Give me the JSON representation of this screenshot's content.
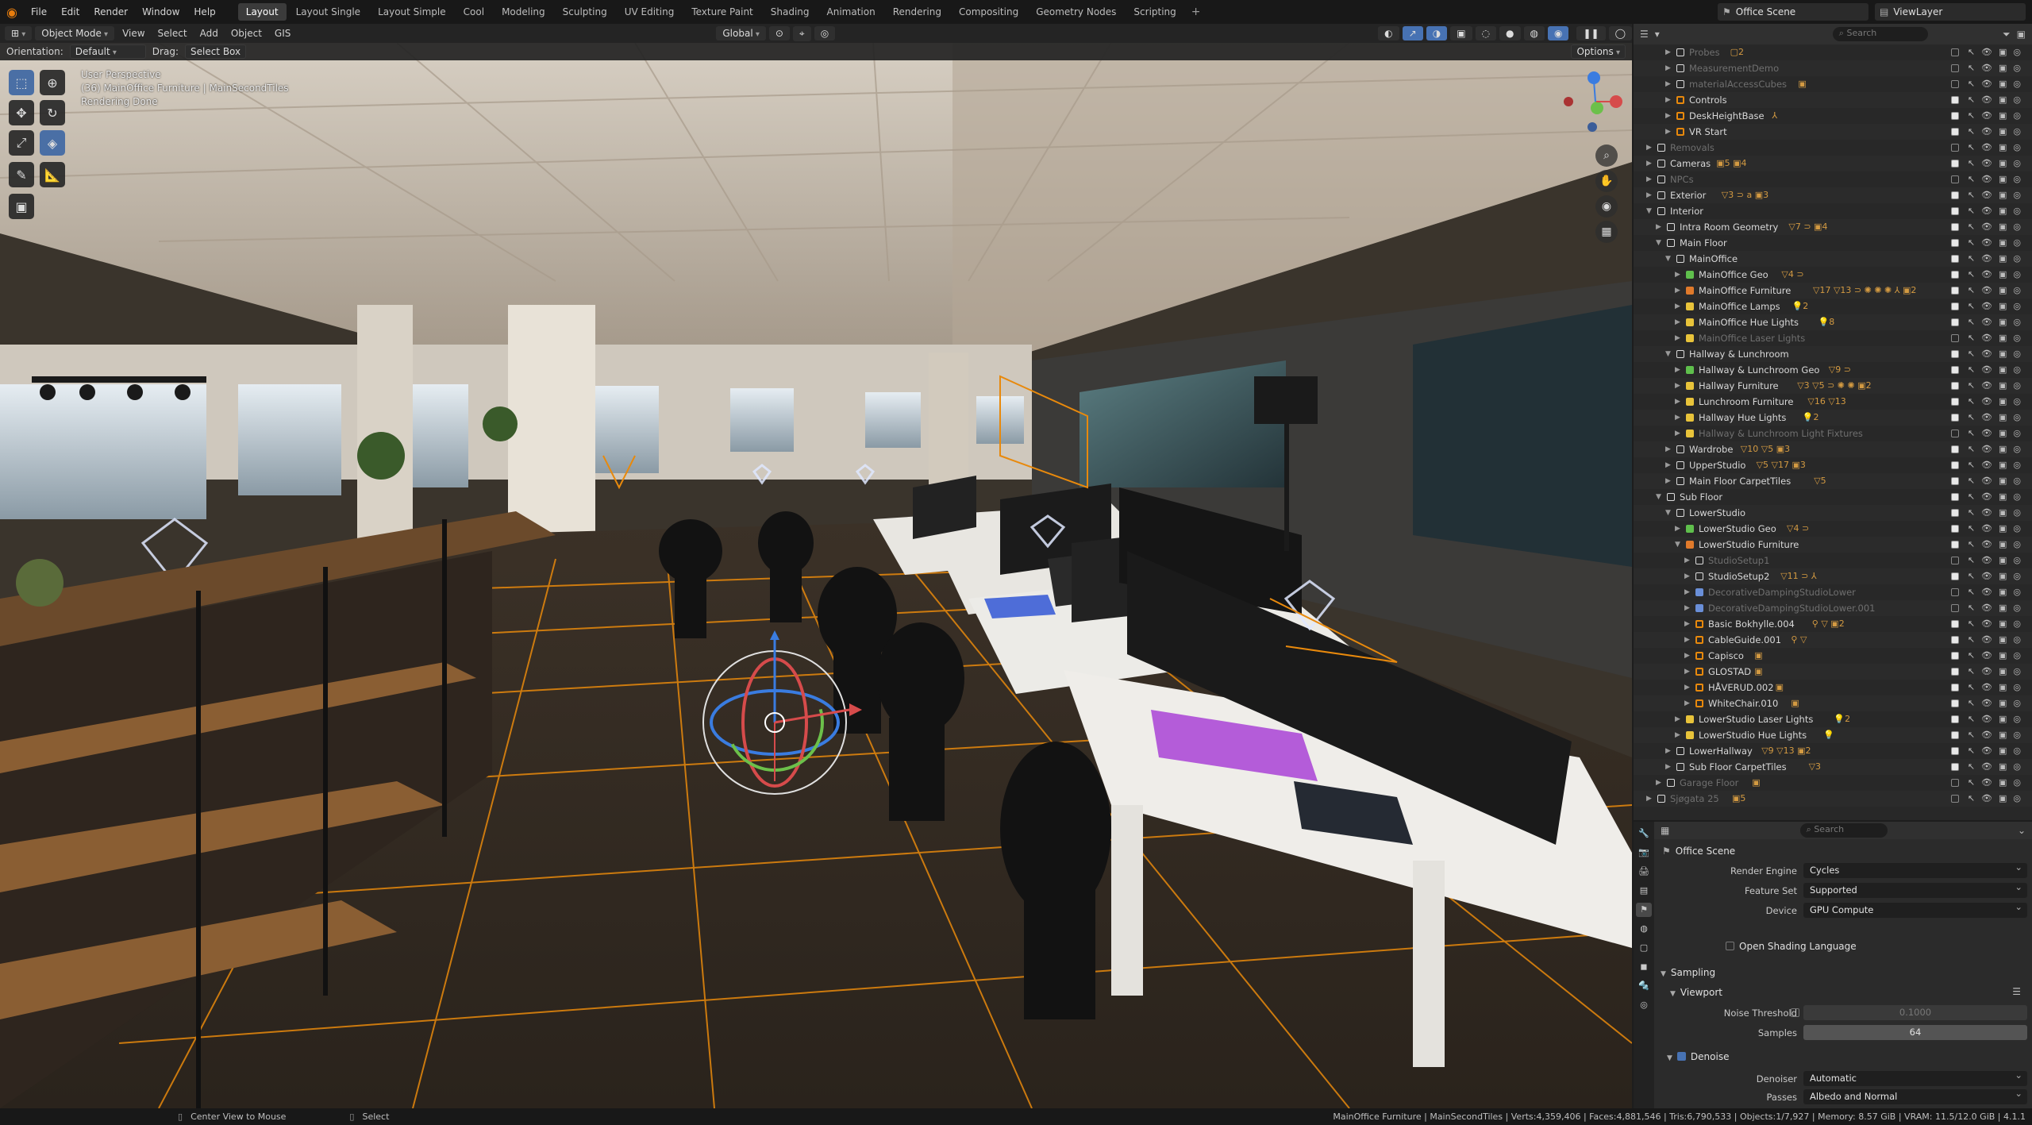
{
  "menu": [
    "File",
    "Edit",
    "Render",
    "Window",
    "Help"
  ],
  "workspaces": [
    {
      "label": "Layout",
      "active": true
    },
    {
      "label": "Layout Single"
    },
    {
      "label": "Layout Simple"
    },
    {
      "label": "Cool"
    },
    {
      "label": "Modeling"
    },
    {
      "label": "Sculpting"
    },
    {
      "label": "UV Editing"
    },
    {
      "label": "Texture Paint"
    },
    {
      "label": "Shading"
    },
    {
      "label": "Animation"
    },
    {
      "label": "Rendering"
    },
    {
      "label": "Compositing"
    },
    {
      "label": "Geometry Nodes"
    },
    {
      "label": "Scripting"
    }
  ],
  "top_right": {
    "scene": "Office Scene",
    "view_layer": "ViewLayer"
  },
  "viewport_header": {
    "mode": "Object Mode",
    "menus": [
      "View",
      "Select",
      "Add",
      "Object",
      "GIS"
    ],
    "transform": "Global"
  },
  "tool_settings": {
    "orientation_label": "Orientation:",
    "orientation_value": "Default",
    "drag_label": "Drag:",
    "drag_value": "Select Box",
    "options": "Options"
  },
  "viewport_overlay": {
    "view_name": "User Perspective",
    "collection_info": "(36) MainOffice Furniture | MainSecondTiles",
    "status": "Rendering Done"
  },
  "outliner": {
    "search_placeholder": "Search",
    "rows": [
      {
        "label": "Probes",
        "indent": 3,
        "type": "collection",
        "dim": true,
        "extra": "▢2"
      },
      {
        "label": "MeasurementDemo",
        "indent": 3,
        "type": "collection",
        "dim": true
      },
      {
        "label": "materialAccessCubes",
        "indent": 3,
        "type": "collection",
        "dim": true,
        "extra": "▣"
      },
      {
        "label": "Controls",
        "indent": 3,
        "type": "empty"
      },
      {
        "label": "DeskHeightBase",
        "indent": 3,
        "type": "empty",
        "extra": "⅄"
      },
      {
        "label": "VR Start",
        "indent": 3,
        "type": "empty"
      },
      {
        "label": "Removals",
        "indent": 1,
        "type": "collection",
        "dim": true
      },
      {
        "label": "Cameras",
        "indent": 1,
        "type": "collection",
        "extra": "▣5 ▣4"
      },
      {
        "label": "NPCs",
        "indent": 1,
        "type": "collection",
        "dim": true
      },
      {
        "label": "Exterior",
        "indent": 1,
        "type": "collection",
        "extra": "▽3 ⊃ a ▣3"
      },
      {
        "label": "Interior",
        "indent": 1,
        "type": "collection",
        "open": true
      },
      {
        "label": "Intra Room Geometry",
        "indent": 2,
        "type": "collection",
        "extra": "▽7 ⊃ ▣4"
      },
      {
        "label": "Main Floor",
        "indent": 2,
        "type": "collection",
        "open": true
      },
      {
        "label": "MainOffice",
        "indent": 3,
        "type": "collection",
        "open": true
      },
      {
        "label": "MainOffice Geo",
        "indent": 4,
        "type": "green",
        "extra": "▽4 ⊃"
      },
      {
        "label": "MainOffice Furniture",
        "indent": 4,
        "type": "orange",
        "extra": "▽17 ▽13 ⊃ ✺ ✺ ✺ ⅄ ▣2"
      },
      {
        "label": "MainOffice Lamps",
        "indent": 4,
        "type": "yellow",
        "extra": "💡2"
      },
      {
        "label": "MainOffice Hue Lights",
        "indent": 4,
        "type": "yellow",
        "extra": "💡8"
      },
      {
        "label": "MainOffice Laser Lights",
        "indent": 4,
        "type": "yellow",
        "dim": true
      },
      {
        "label": "Hallway & Lunchroom",
        "indent": 3,
        "type": "collection",
        "open": true
      },
      {
        "label": "Hallway & Lunchroom Geo",
        "indent": 4,
        "type": "green",
        "extra": "▽9 ⊃"
      },
      {
        "label": "Hallway Furniture",
        "indent": 4,
        "type": "yellow",
        "extra": "▽3 ▽5 ⊃ ✺ ✺ ▣2"
      },
      {
        "label": "Lunchroom Furniture",
        "indent": 4,
        "type": "yellow",
        "extra": "▽16 ▽13"
      },
      {
        "label": "Hallway Hue Lights",
        "indent": 4,
        "type": "yellow",
        "extra": "💡2"
      },
      {
        "label": "Hallway & Lunchroom Light Fixtures",
        "indent": 4,
        "type": "yellow",
        "dim": true
      },
      {
        "label": "Wardrobe",
        "indent": 3,
        "type": "collection",
        "extra": "▽10 ▽5 ▣3"
      },
      {
        "label": "UpperStudio",
        "indent": 3,
        "type": "collection",
        "extra": "▽5 ▽17 ▣3"
      },
      {
        "label": "Main Floor CarpetTiles",
        "indent": 3,
        "type": "collection",
        "extra": "▽5"
      },
      {
        "label": "Sub Floor",
        "indent": 2,
        "type": "collection",
        "open": true
      },
      {
        "label": "LowerStudio",
        "indent": 3,
        "type": "collection",
        "open": true
      },
      {
        "label": "LowerStudio Geo",
        "indent": 4,
        "type": "green",
        "extra": "▽4 ⊃"
      },
      {
        "label": "LowerStudio Furniture",
        "indent": 4,
        "type": "orange",
        "open": true
      },
      {
        "label": "StudioSetup1",
        "indent": 5,
        "type": "collection",
        "dim": true
      },
      {
        "label": "StudioSetup2",
        "indent": 5,
        "type": "collection",
        "extra": "▽11 ⊃ ⅄"
      },
      {
        "label": "DecorativeDampingStudioLower",
        "indent": 5,
        "type": "blue",
        "dim": true
      },
      {
        "label": "DecorativeDampingStudioLower.001",
        "indent": 5,
        "type": "blue",
        "dim": true
      },
      {
        "label": "Basic Bokhylle.004",
        "indent": 5,
        "type": "mesh",
        "extra": "⚲ ▽ ▣2"
      },
      {
        "label": "CableGuide.001",
        "indent": 5,
        "type": "mesh",
        "extra": "⚲ ▽"
      },
      {
        "label": "Capisco",
        "indent": 5,
        "type": "mesh",
        "extra": "▣"
      },
      {
        "label": "GLOSTAD",
        "indent": 5,
        "type": "mesh",
        "extra": "▣"
      },
      {
        "label": "HÅVERUD.002",
        "indent": 5,
        "type": "mesh",
        "extra": "▣"
      },
      {
        "label": "WhiteChair.010",
        "indent": 5,
        "type": "mesh",
        "extra": "▣"
      },
      {
        "label": "LowerStudio Laser Lights",
        "indent": 4,
        "type": "yellow",
        "extra": "💡2"
      },
      {
        "label": "LowerStudio Hue Lights",
        "indent": 4,
        "type": "yellow",
        "extra": "💡"
      },
      {
        "label": "LowerHallway",
        "indent": 3,
        "type": "collection",
        "extra": "▽9 ▽13 ▣2"
      },
      {
        "label": "Sub Floor CarpetTiles",
        "indent": 3,
        "type": "collection",
        "extra": "▽3"
      },
      {
        "label": "Garage Floor",
        "indent": 2,
        "type": "collection",
        "dim": true,
        "extra": "▣"
      },
      {
        "label": "Sjøgata 25",
        "indent": 1,
        "type": "collection",
        "dim": true,
        "extra": "▣5"
      }
    ]
  },
  "properties": {
    "search_placeholder": "Search",
    "scene_name": "Office Scene",
    "render_engine_label": "Render Engine",
    "render_engine": "Cycles",
    "feature_set_label": "Feature Set",
    "feature_set": "Supported",
    "device_label": "Device",
    "device": "GPU Compute",
    "osl_label": "Open Shading Language",
    "sampling_label": "Sampling",
    "viewport_label": "Viewport",
    "noise_threshold_label": "Noise Threshold",
    "noise_threshold": "0.1000",
    "samples_label": "Samples",
    "samples": "64",
    "denoise_label": "Denoise",
    "denoiser_label": "Denoiser",
    "denoiser": "Automatic",
    "passes_label": "Passes",
    "passes": "Albedo and Normal"
  },
  "statusbar": {
    "hint_left": "Center View to Mouse",
    "hint_select": "Select",
    "stats": "MainOffice Furniture | MainSecondTiles | Verts:4,359,406 | Faces:4,881,546 | Tris:6,790,533 | Objects:1/7,927 | Memory: 8.57 GiB | VRAM: 11.5/12.0 GiB | 4.1.1"
  },
  "colors": {
    "accent_orange": "#e8890c",
    "active_blue": "#4772b3",
    "collection_green": "#5fbf4c",
    "collection_yellow": "#e8c33a"
  }
}
